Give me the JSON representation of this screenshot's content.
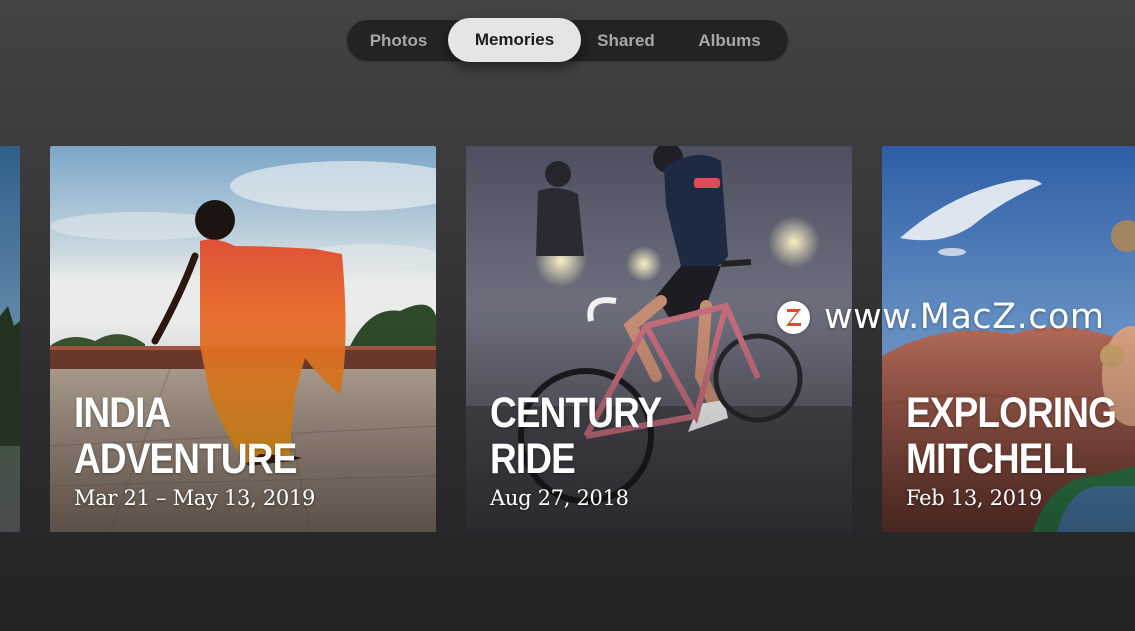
{
  "tabs": [
    {
      "label": "Photos",
      "active": false
    },
    {
      "label": "Memories",
      "active": true
    },
    {
      "label": "Shared",
      "active": false
    },
    {
      "label": "Albums",
      "active": false
    }
  ],
  "memories": [
    {
      "title_lines": [
        "INDIA",
        "ADVENTURE"
      ],
      "date": "Mar 21 – May 13, 2019",
      "photo": "woman-in-red-sari-dancing-photo"
    },
    {
      "title_lines": [
        "CENTURY",
        "RIDE"
      ],
      "date": "Aug 27, 2018",
      "photo": "cyclists-in-fog-photo"
    },
    {
      "title_lines": [
        "EXPLORING",
        "MITCHELL"
      ],
      "date": "Feb 13, 2019",
      "photo": "painted-hills-blue-sky-photo"
    }
  ],
  "watermark": {
    "text": "www.MacZ.com",
    "logo_letter": "Z",
    "logo_color": "#e8442b"
  },
  "colors": {
    "active_tab_bg": "#e5e5e7",
    "tabbar_bg": "#232325",
    "background": "#2e2e30"
  }
}
